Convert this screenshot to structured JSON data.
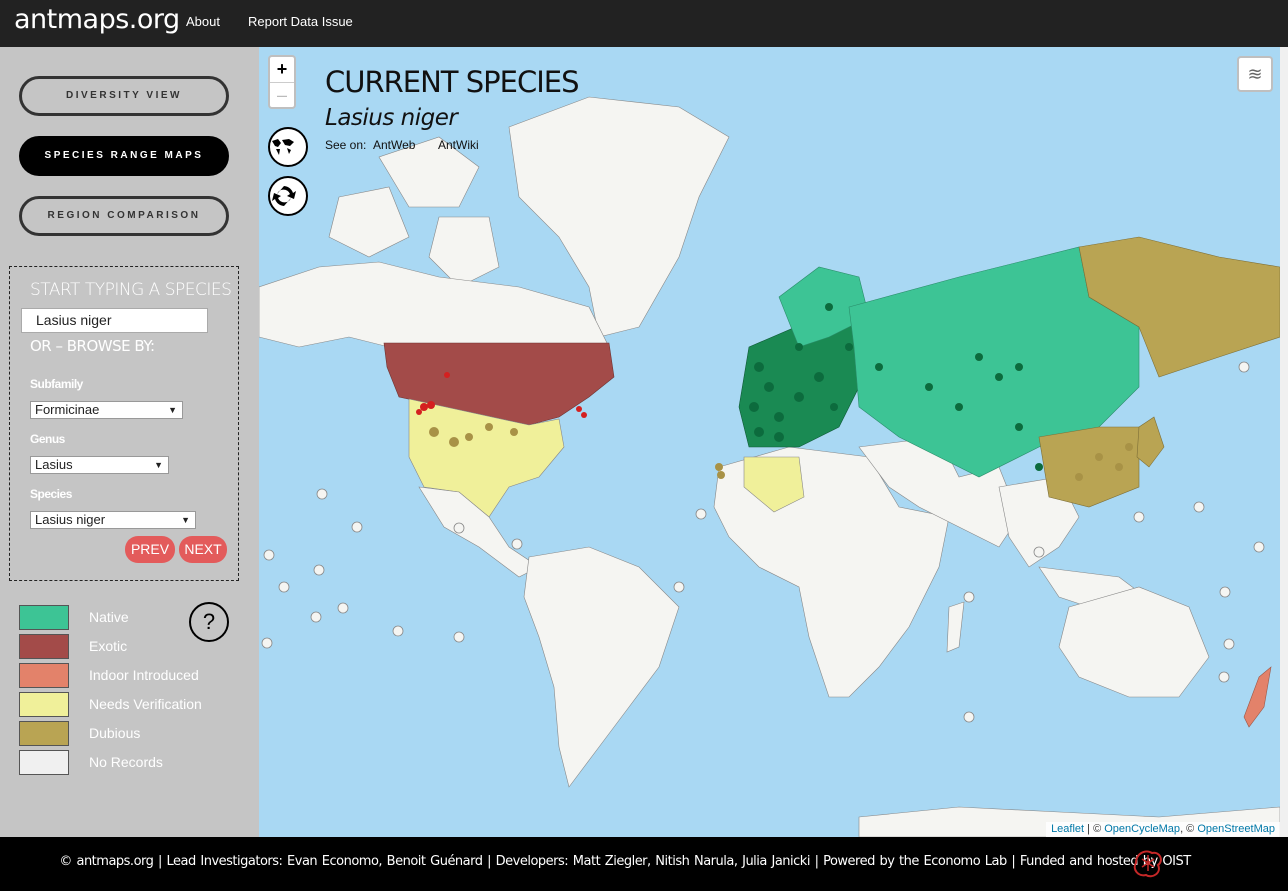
{
  "nav": {
    "brand": "antmaps.org",
    "about": "About",
    "report": "Report Data Issue"
  },
  "sidebar": {
    "view_buttons": [
      "DIVERSITY VIEW",
      "SPECIES RANGE MAPS",
      "REGION COMPARISON"
    ],
    "search_title": "START TYPING A SPECIES",
    "search_value": "Lasius niger",
    "or_browse": "OR – BROWSE BY:",
    "subfamily_label": "Subfamily",
    "subfamily_value": "Formicinae",
    "genus_label": "Genus",
    "genus_value": "Lasius",
    "species_label": "Species",
    "species_value": "Lasius niger",
    "prev": "PREV",
    "next": "NEXT",
    "help": "?"
  },
  "legend": [
    {
      "label": "Native",
      "color": "#3dc495"
    },
    {
      "label": "Exotic",
      "color": "#a34b49"
    },
    {
      "label": "Indoor Introduced",
      "color": "#e3826a"
    },
    {
      "label": "Needs Verification",
      "color": "#f0f09a"
    },
    {
      "label": "Dubious",
      "color": "#b9a453"
    },
    {
      "label": "No Records",
      "color": "#f0f0f0"
    }
  ],
  "map": {
    "zoom_in": "+",
    "zoom_out": "–",
    "title": "CURRENT SPECIES",
    "species": "Lasius niger",
    "see_on": "See on:",
    "antweb": "AntWeb",
    "antwiki": "AntWiki",
    "attribution": {
      "leaflet": "Leaflet",
      "sep1": " | © ",
      "ocm": "OpenCycleMap",
      "sep2": ", © ",
      "osm": "OpenStreetMap"
    }
  },
  "footer": {
    "text": "© antmaps.org  |  Lead Investigators: Evan Economo, Benoit Guénard  |  Developers: Matt Ziegler, Nitish Narula, Julia Janicki  |  Powered by the Economo Lab  |  Funded and hosted by OIST"
  }
}
